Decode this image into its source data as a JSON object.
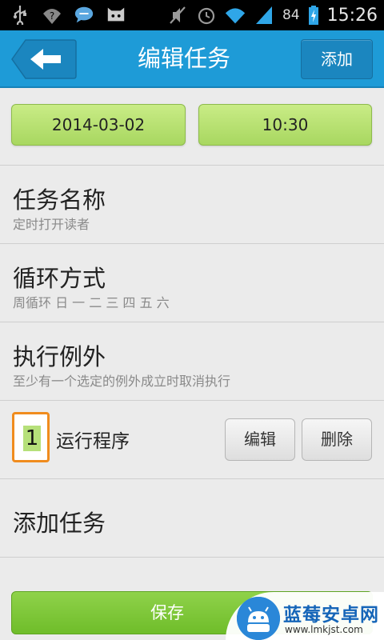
{
  "status_bar": {
    "battery_percent": "84",
    "time": "15:26",
    "icons": [
      "usb-icon",
      "wifi-question-icon",
      "chat-bubble-icon",
      "cat-face-icon",
      "mute-icon",
      "alarm-icon",
      "wifi-icon",
      "signal-icon",
      "battery-icon"
    ]
  },
  "header": {
    "title": "编辑任务",
    "add_label": "添加",
    "accent_color": "#1e9bd7"
  },
  "schedule": {
    "date": "2014-03-02",
    "time": "10:30"
  },
  "task_name": {
    "title": "任务名称",
    "value": "定时打开读者"
  },
  "repeat": {
    "title": "循环方式",
    "value": "周循环 日 一 二 三 四 五 六"
  },
  "exception": {
    "title": "执行例外",
    "value": "至少有一个选定的例外成立时取消执行"
  },
  "program": {
    "index": "1",
    "label": "运行程序",
    "edit_label": "编辑",
    "delete_label": "删除"
  },
  "add_task": {
    "title": "添加任务"
  },
  "save_label": "保存",
  "watermark": {
    "title": "蓝莓安卓网",
    "url": "www.lmkjst.com"
  }
}
